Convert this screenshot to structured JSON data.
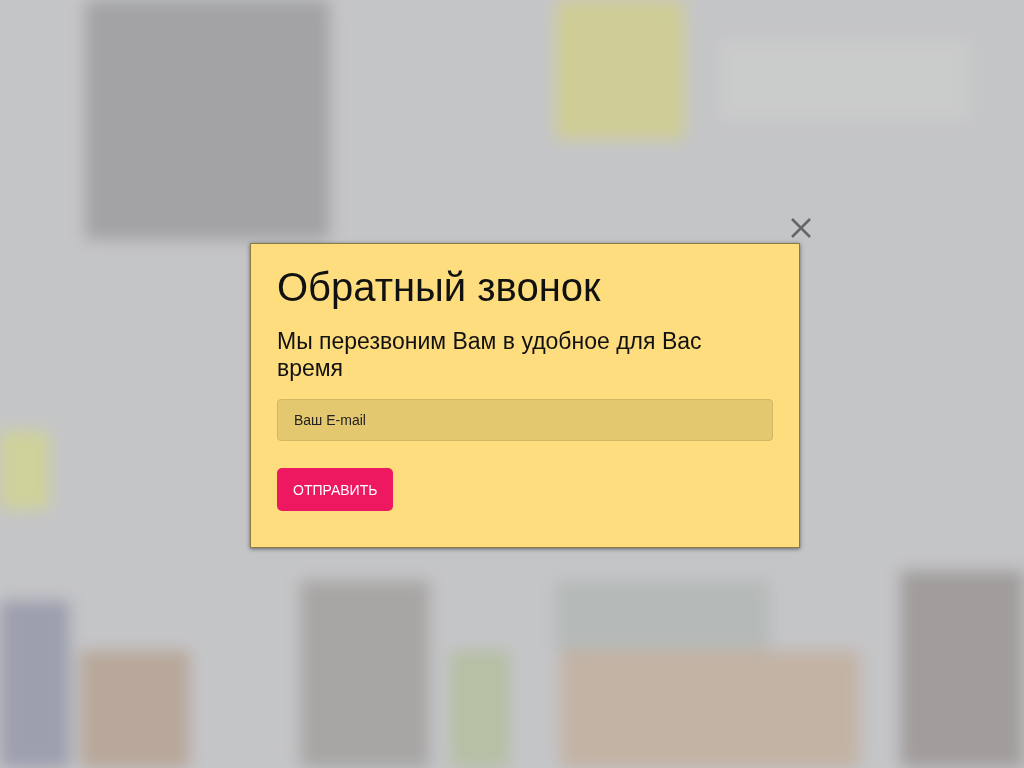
{
  "dialog": {
    "title": "Обратный звонок",
    "subtitle": "Мы перезвоним Вам в удобное для Вас время",
    "email_field": {
      "placeholder": "Ваш E-mail"
    },
    "submit_button": "ОТПРАВИТЬ"
  }
}
